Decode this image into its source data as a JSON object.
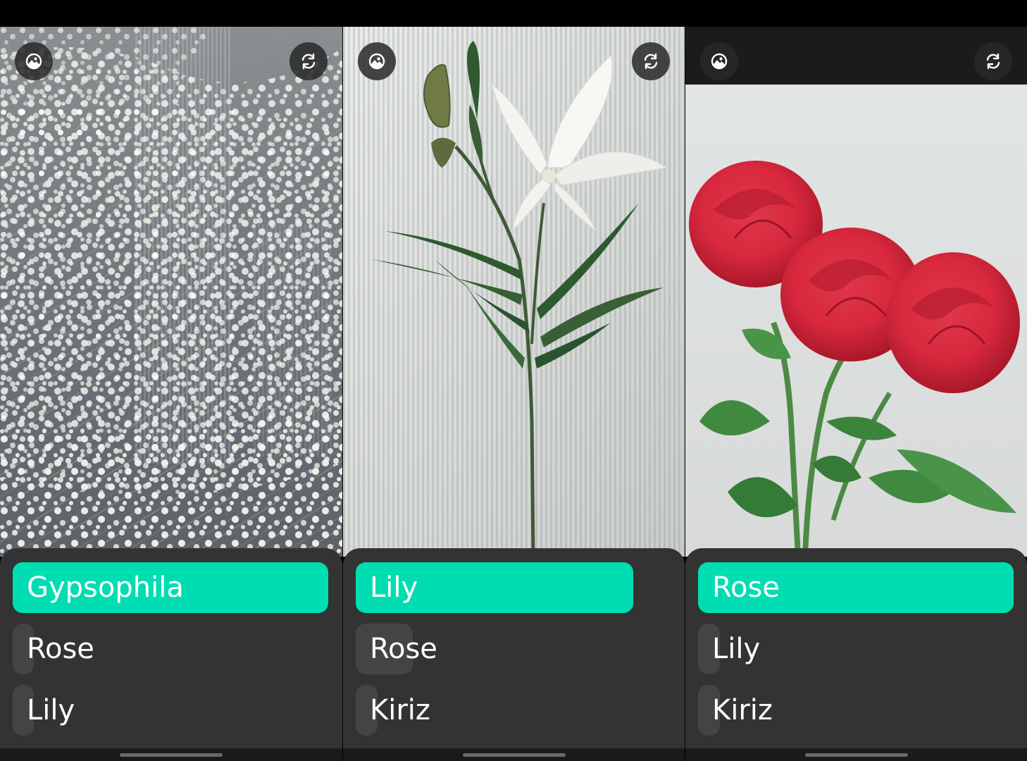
{
  "screens": [
    {
      "subject": "gypsophila",
      "results": [
        {
          "label": "Gypsophila",
          "score": 1.0
        },
        {
          "label": "Rose",
          "score": 0.06
        },
        {
          "label": "Lily",
          "score": 0.06
        }
      ]
    },
    {
      "subject": "lily",
      "results": [
        {
          "label": "Lily",
          "score": 0.88
        },
        {
          "label": "Rose",
          "score": 0.18
        },
        {
          "label": "Kiriz",
          "score": 0.07
        }
      ]
    },
    {
      "subject": "rose",
      "results": [
        {
          "label": "Rose",
          "score": 1.0
        },
        {
          "label": "Lily",
          "score": 0.07
        },
        {
          "label": "Kiriz",
          "score": 0.07
        }
      ]
    }
  ],
  "icons": {
    "gallery": "gallery-icon",
    "switch_camera": "switch-camera-icon"
  },
  "colors": {
    "accent": "#00DDB2",
    "panel": "#333333",
    "bar": "#444444",
    "button": "#282828"
  }
}
